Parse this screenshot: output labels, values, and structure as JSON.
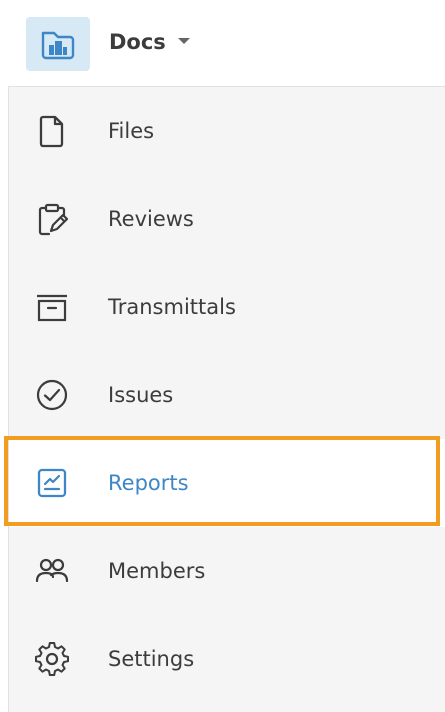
{
  "header": {
    "title": "Docs",
    "logo_icon": "building-folder-icon",
    "dropdown_icon": "caret-down-icon"
  },
  "nav": {
    "items": [
      {
        "label": "Files",
        "icon": "file-icon"
      },
      {
        "label": "Reviews",
        "icon": "clipboard-edit-icon"
      },
      {
        "label": "Transmittals",
        "icon": "archive-tray-icon"
      },
      {
        "label": "Issues",
        "icon": "check-circle-icon"
      },
      {
        "label": "Reports",
        "icon": "report-chart-icon",
        "active": true
      },
      {
        "label": "Members",
        "icon": "members-icon"
      },
      {
        "label": "Settings",
        "icon": "gear-icon"
      }
    ]
  },
  "colors": {
    "accent": "#3f86c6",
    "highlight": "#f29d22",
    "sidebar_bg": "#f5f5f5",
    "logo_bg": "#d6e9f5",
    "text": "#3c3c3c"
  }
}
